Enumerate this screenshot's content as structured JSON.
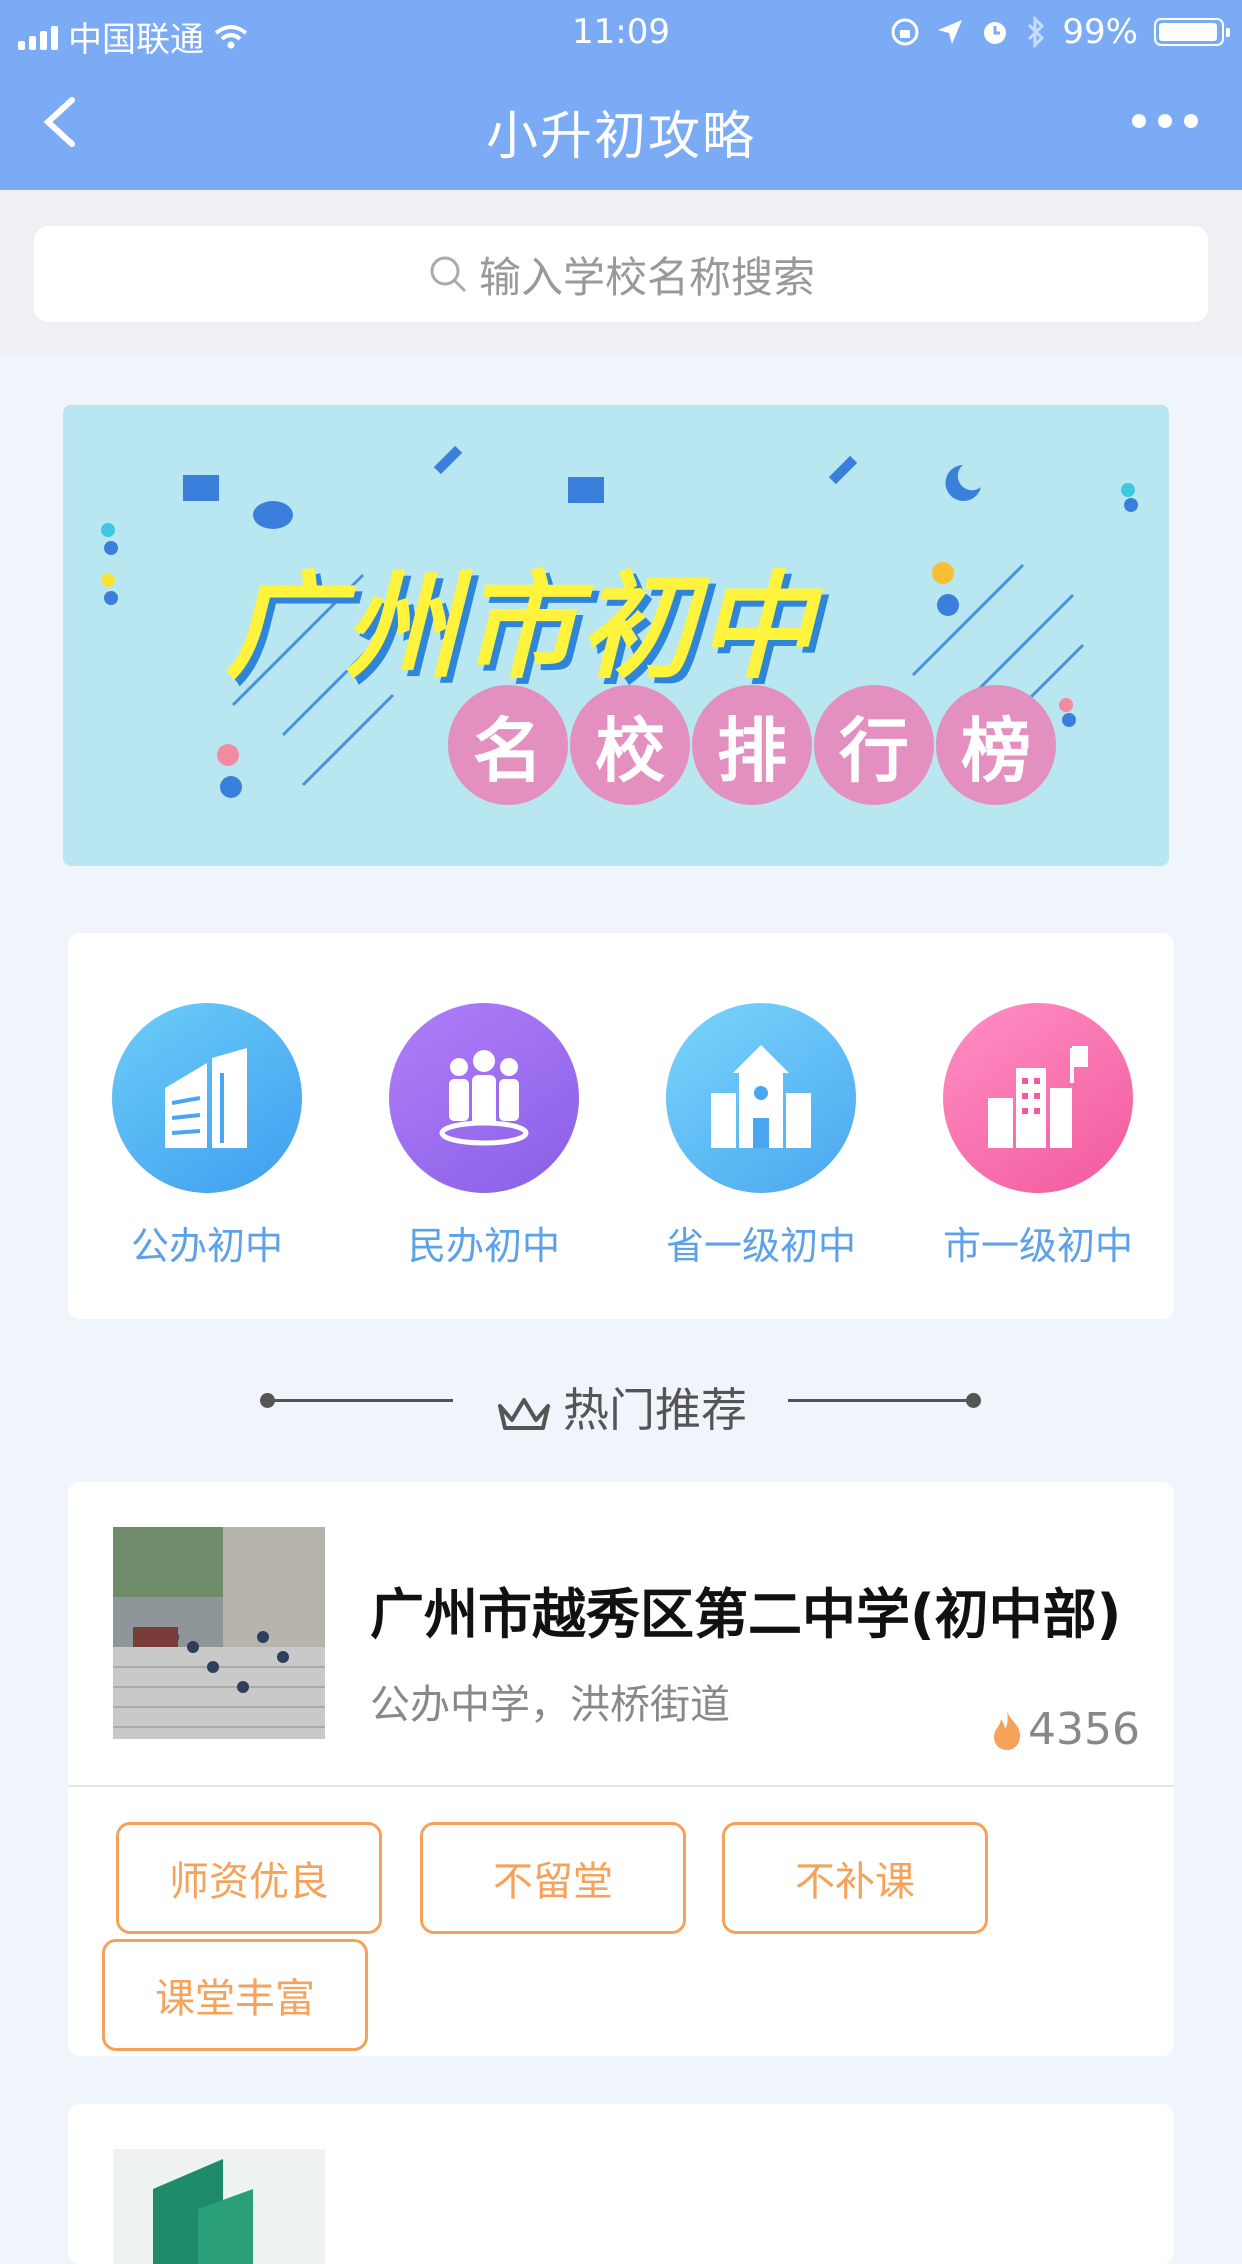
{
  "status": {
    "carrier": "中国联通",
    "time": "11:09",
    "battery": "99%"
  },
  "nav": {
    "title": "小升初攻略"
  },
  "search": {
    "placeholder": "输入学校名称搜索"
  },
  "banner": {
    "headline": "广州市初中",
    "pills": [
      "名",
      "校",
      "排",
      "行",
      "榜"
    ]
  },
  "categories": [
    {
      "label": "公办初中"
    },
    {
      "label": "民办初中"
    },
    {
      "label": "省一级初中"
    },
    {
      "label": "市一级初中"
    }
  ],
  "hot": {
    "title": "热门推荐"
  },
  "school": {
    "name": "广州市越秀区第二中学(初中部)",
    "meta": "公办中学，洪桥街道",
    "heat": "4356",
    "tags": [
      "师资优良",
      "不留堂",
      "不补课",
      "课堂丰富"
    ]
  },
  "colors": {
    "nav": "#7cabf5",
    "accent": "#5da2e8",
    "tag": "#f5a25b"
  }
}
